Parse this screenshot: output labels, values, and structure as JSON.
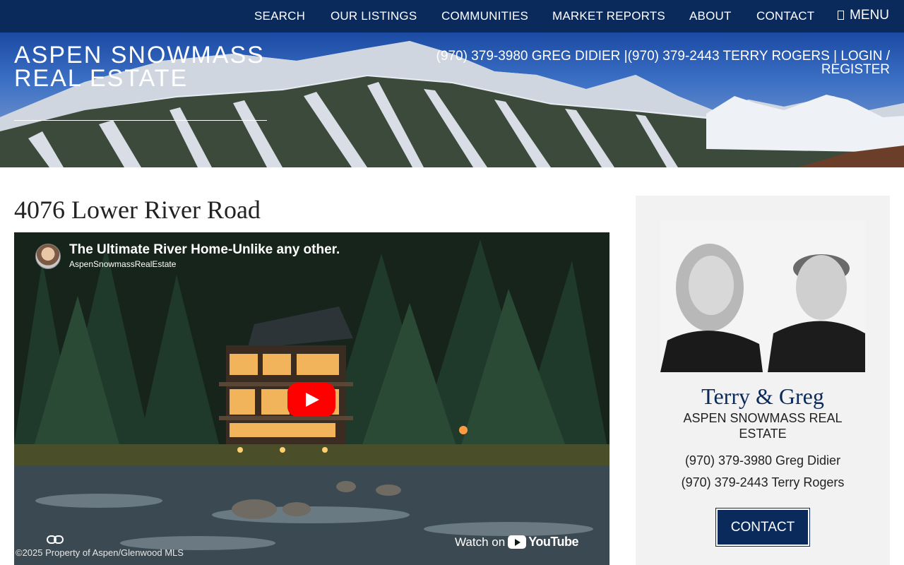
{
  "nav": {
    "items": [
      {
        "label": "SEARCH"
      },
      {
        "label": "OUR LISTINGS"
      },
      {
        "label": "COMMUNITIES"
      },
      {
        "label": "MARKET REPORTS"
      },
      {
        "label": "ABOUT"
      },
      {
        "label": "CONTACT"
      }
    ],
    "menu_label": "MENU",
    "bg_color": "#0b2a5c"
  },
  "header": {
    "brand": "ASPEN SNOWMASS REAL ESTATE",
    "phone_greg": "(970) 379-3980 GREG DIDIER",
    "separator1": "|",
    "phone_terry": "(970) 379-2443 TERRY ROGERS",
    "separator2": "|",
    "login": "LOGIN",
    "slash": "/",
    "register": "REGISTER"
  },
  "main": {
    "title": "4076 Lower River Road"
  },
  "video": {
    "title": "The Ultimate River Home-Unlike any other.",
    "channel": "AspenSnowmassRealEstate",
    "copyright": "©2025 Property of Aspen/Glenwood MLS",
    "watch_on": "Watch on",
    "youtube": "YouTube",
    "icons": {
      "play": "play-icon",
      "link": "link-icon"
    }
  },
  "sidebar": {
    "names": "Terry & Greg",
    "company": "ASPEN SNOWMASS REAL ESTATE",
    "phone1": "(970) 379-3980 Greg Didier",
    "phone2": "(970) 379-2443 Terry Rogers",
    "contact_button": "CONTACT",
    "accent_color": "#0b2a5c"
  }
}
